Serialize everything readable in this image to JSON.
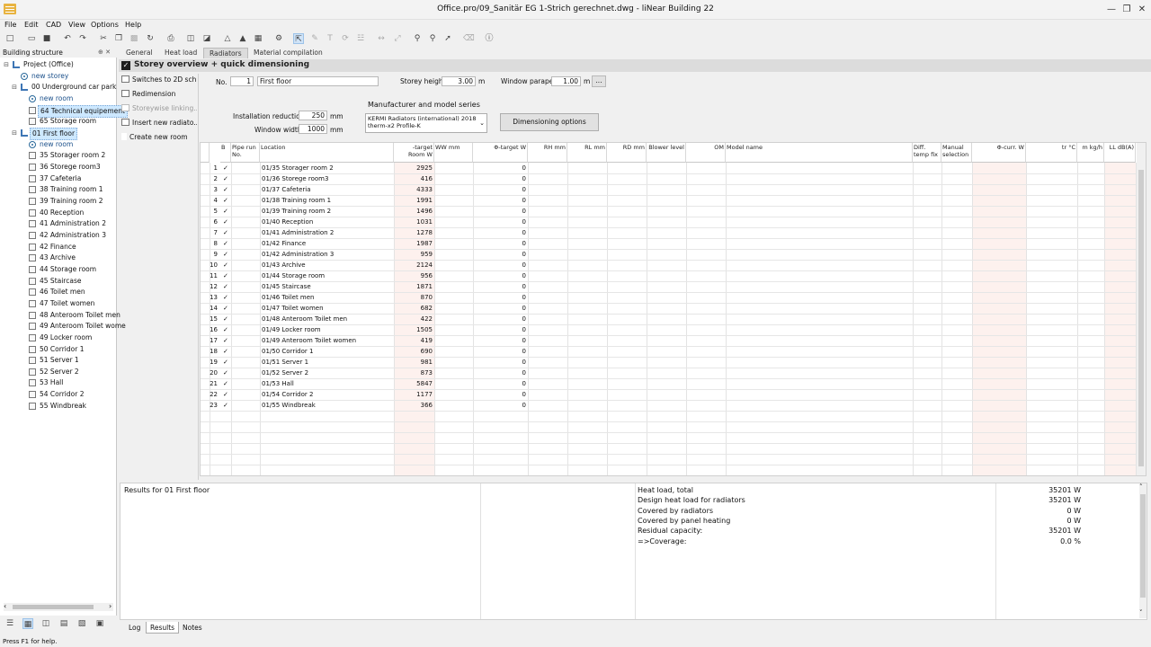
{
  "window": {
    "title": "Office.pro/09_Sanitär EG 1-Strich gerechnet.dwg - liNear Building 22"
  },
  "menu": [
    "File",
    "Edit",
    "CAD",
    "View",
    "Options",
    "Help"
  ],
  "tree": {
    "header": "Building structure",
    "pin": "⊕ ✕",
    "items": [
      {
        "label": "Project (Office)",
        "level": 0,
        "exp": "⊟",
        "icon": "floor"
      },
      {
        "label": "new storey",
        "level": 1,
        "icon": "new"
      },
      {
        "label": "00 Underground car park",
        "level": 1,
        "exp": "⊟",
        "icon": "floor"
      },
      {
        "label": "new room",
        "level": 2,
        "icon": "new"
      },
      {
        "label": "64 Technical equipement",
        "level": 2,
        "icon": "room",
        "selected": true
      },
      {
        "label": "65 Storage room",
        "level": 2,
        "icon": "room"
      },
      {
        "label": "01 First floor",
        "level": 1,
        "exp": "⊟",
        "icon": "floor",
        "selected": true
      },
      {
        "label": "new room",
        "level": 2,
        "icon": "new"
      },
      {
        "label": "35 Storager room 2",
        "level": 2,
        "icon": "room"
      },
      {
        "label": "36 Storege room3",
        "level": 2,
        "icon": "room"
      },
      {
        "label": "37 Cafeteria",
        "level": 2,
        "icon": "room"
      },
      {
        "label": "38 Training room 1",
        "level": 2,
        "icon": "room"
      },
      {
        "label": "39 Training room 2",
        "level": 2,
        "icon": "room"
      },
      {
        "label": "40 Reception",
        "level": 2,
        "icon": "room"
      },
      {
        "label": "41  Administration 2",
        "level": 2,
        "icon": "room"
      },
      {
        "label": "42  Administration  3",
        "level": 2,
        "icon": "room"
      },
      {
        "label": "42 Finance",
        "level": 2,
        "icon": "room"
      },
      {
        "label": "43 Archive",
        "level": 2,
        "icon": "room"
      },
      {
        "label": "44 Storage room",
        "level": 2,
        "icon": "room"
      },
      {
        "label": "45 Staircase",
        "level": 2,
        "icon": "room"
      },
      {
        "label": "46 Toilet men",
        "level": 2,
        "icon": "room"
      },
      {
        "label": "47 Toilet women",
        "level": 2,
        "icon": "room"
      },
      {
        "label": "48 Anteroom Toilet men",
        "level": 2,
        "icon": "room"
      },
      {
        "label": "49 Anteroom Toilet wome",
        "level": 2,
        "icon": "room"
      },
      {
        "label": "49 Locker room",
        "level": 2,
        "icon": "room"
      },
      {
        "label": "50 Corridor 1",
        "level": 2,
        "icon": "room"
      },
      {
        "label": "51 Server 1",
        "level": 2,
        "icon": "room"
      },
      {
        "label": "52 Server 2",
        "level": 2,
        "icon": "room"
      },
      {
        "label": "53 Hall",
        "level": 2,
        "icon": "room"
      },
      {
        "label": "54 Corridor  2",
        "level": 2,
        "icon": "room"
      },
      {
        "label": "55 Windbreak",
        "level": 2,
        "icon": "room"
      }
    ]
  },
  "tabs": [
    "General",
    "Heat load",
    "Radiators",
    "Material compilation"
  ],
  "active_tab": 2,
  "section_title": "Storey overview + quick dimensioning",
  "actions": [
    {
      "label": "Switches to 2D sch...",
      "disabled": false
    },
    {
      "label": "Redimension",
      "disabled": false
    },
    {
      "label": "Storeywise linking...",
      "disabled": true
    },
    {
      "label": "Insert new radiato...",
      "disabled": false
    },
    {
      "label": "Create new room",
      "disabled": false
    }
  ],
  "storey": {
    "no_label": "No.",
    "no_value": "1",
    "name_value": "First floor",
    "height_label": "Storey height",
    "height_value": "3.00",
    "height_unit": "m",
    "parapet_label": "Window parapet",
    "parapet_value": "1.00",
    "parapet_unit": "m",
    "more_button": "..."
  },
  "install": {
    "reduction_label": "Installation reduction",
    "reduction_value": "250",
    "reduction_unit": "mm",
    "width_label": "Window width",
    "width_value": "1000",
    "width_unit": "mm"
  },
  "manufacturer": {
    "label": "Manufacturer and model series",
    "line1": "KERMI Radiators (international) 2018",
    "line2": "therm-x2 Profile-K",
    "button": "Dimensioning options"
  },
  "grid": {
    "headers": {
      "b": "B",
      "pipe": "Pipe run No.",
      "location": "Location",
      "target": "-target Room W",
      "ww": "WW mm",
      "phitarget": "Φ-target W",
      "rh": "RH mm",
      "rl": "RL mm",
      "rd": "RD mm",
      "blower": "Blower level",
      "om": "OM",
      "model": "Model name",
      "difftemp": "Diff. temp fix",
      "manual": "Manual selection",
      "phicurr": "Φ-curr. W",
      "tr": "tr °C",
      "m": "m kg/h",
      "ll": "LL dB(A)"
    },
    "rows": [
      {
        "no": "1",
        "loc": "01/35 Storager room 2",
        "target": "2925",
        "phi": "0"
      },
      {
        "no": "2",
        "loc": "01/36 Storege room3",
        "target": "416",
        "phi": "0"
      },
      {
        "no": "3",
        "loc": "01/37 Cafeteria",
        "target": "4333",
        "phi": "0"
      },
      {
        "no": "4",
        "loc": "01/38 Training room 1",
        "target": "1991",
        "phi": "0"
      },
      {
        "no": "5",
        "loc": "01/39 Training room 2",
        "target": "1496",
        "phi": "0"
      },
      {
        "no": "6",
        "loc": "01/40 Reception",
        "target": "1031",
        "phi": "0"
      },
      {
        "no": "7",
        "loc": "01/41  Administration 2",
        "target": "1278",
        "phi": "0"
      },
      {
        "no": "8",
        "loc": "01/42 Finance",
        "target": "1987",
        "phi": "0"
      },
      {
        "no": "9",
        "loc": "01/42  Administration  3",
        "target": "959",
        "phi": "0"
      },
      {
        "no": "10",
        "loc": "01/43 Archive",
        "target": "2124",
        "phi": "0"
      },
      {
        "no": "11",
        "loc": "01/44 Storage room",
        "target": "956",
        "phi": "0"
      },
      {
        "no": "12",
        "loc": "01/45 Staircase",
        "target": "1871",
        "phi": "0"
      },
      {
        "no": "13",
        "loc": "01/46 Toilet men",
        "target": "870",
        "phi": "0"
      },
      {
        "no": "14",
        "loc": "01/47 Toilet women",
        "target": "682",
        "phi": "0"
      },
      {
        "no": "15",
        "loc": "01/48 Anteroom Toilet men",
        "target": "422",
        "phi": "0"
      },
      {
        "no": "16",
        "loc": "01/49 Locker room",
        "target": "1505",
        "phi": "0"
      },
      {
        "no": "17",
        "loc": "01/49 Anteroom Toilet women",
        "target": "419",
        "phi": "0"
      },
      {
        "no": "18",
        "loc": "01/50 Corridor 1",
        "target": "690",
        "phi": "0"
      },
      {
        "no": "19",
        "loc": "01/51 Server 1",
        "target": "981",
        "phi": "0"
      },
      {
        "no": "20",
        "loc": "01/52 Server 2",
        "target": "873",
        "phi": "0"
      },
      {
        "no": "21",
        "loc": "01/53 Hall",
        "target": "5847",
        "phi": "0"
      },
      {
        "no": "22",
        "loc": "01/54 Corridor  2",
        "target": "1177",
        "phi": "0"
      },
      {
        "no": "23",
        "loc": "01/55 Windbreak",
        "target": "366",
        "phi": "0"
      }
    ]
  },
  "results": {
    "title": "Results for 01 First floor",
    "items": [
      {
        "label": "Heat load, total",
        "value": "35201 W"
      },
      {
        "label": "Design heat load for radiators",
        "value": "35201 W"
      },
      {
        "label": "Covered by radiators",
        "value": "0 W"
      },
      {
        "label": "Covered by panel heating",
        "value": "0 W"
      },
      {
        "label": "Residual capacity:",
        "value": "35201 W"
      },
      {
        "label": " =>Coverage:",
        "value": "0.0 %"
      }
    ]
  },
  "bottom_tabs": [
    "Log",
    "Results",
    "Notes"
  ],
  "active_bottom_tab": 1,
  "status": "Press F1 for help.",
  "colors": {
    "accent": "#cde8ff",
    "pink": "#fdf1ee",
    "appicon": "#e8b340"
  }
}
